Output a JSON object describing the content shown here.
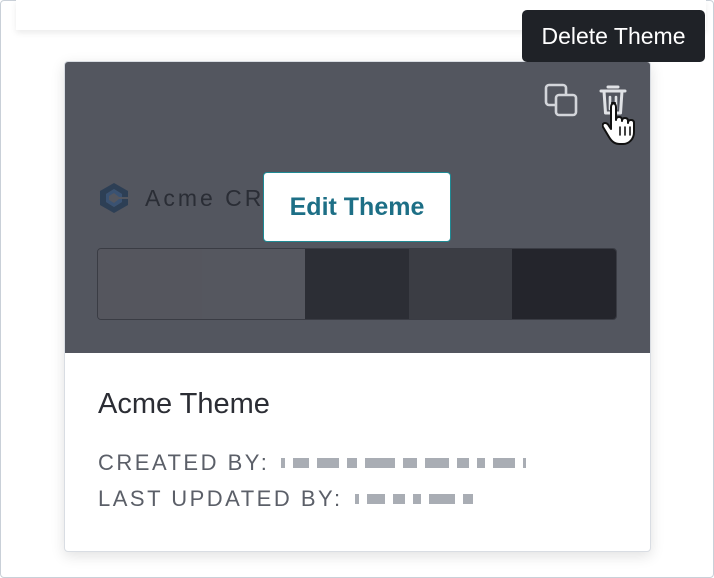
{
  "tooltip": {
    "text": "Delete Theme"
  },
  "card": {
    "actions": {
      "copy_icon": "copy-icon",
      "delete_icon": "trash-icon"
    },
    "preview": {
      "logo_text": "Acme CR",
      "edit_button_label": "Edit Theme",
      "palette": [
        "#55565e",
        "#55575f",
        "#2c2e35",
        "#3b3d44",
        "#24252c"
      ]
    },
    "name": "Acme Theme",
    "created_by_label": "CREATED BY:",
    "last_updated_by_label": "LAST UPDATED BY:"
  },
  "colors": {
    "preview_bg": "#53565f",
    "accent": "#1f8a94",
    "tooltip_bg": "#1f2227"
  }
}
